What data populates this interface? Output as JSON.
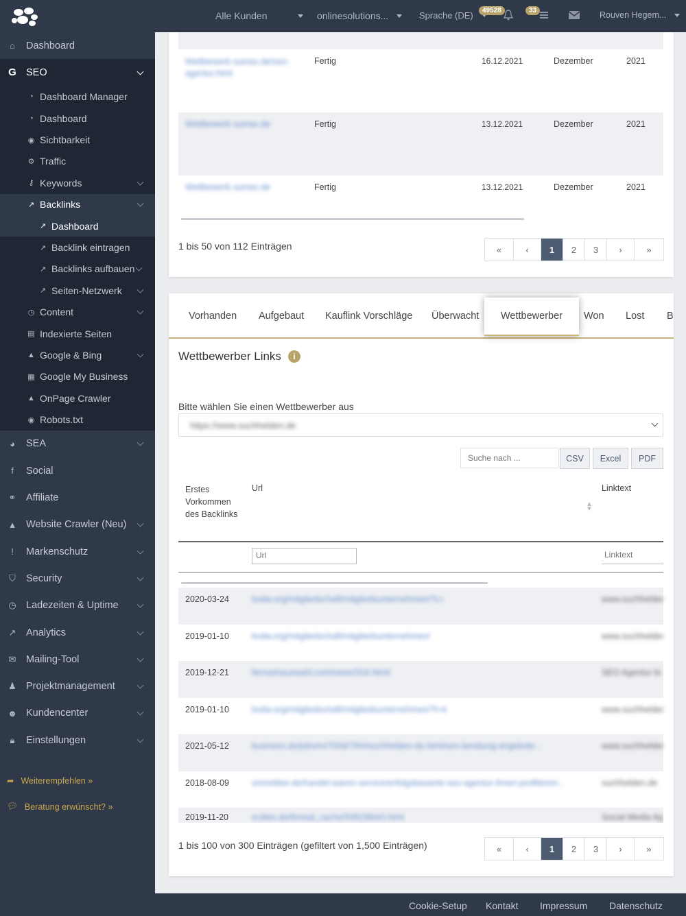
{
  "topbar": {
    "customer": "Alle Kunden",
    "project": "onlinesolutions...",
    "language": "Sprache (DE)",
    "badge1": "49528",
    "badge2": "33",
    "user": "Rouven Hegem..."
  },
  "sidebar": {
    "dashboard": "Dashboard",
    "seo": "SEO",
    "seo_items": [
      {
        "label": "Dashboard Manager"
      },
      {
        "label": "Dashboard"
      },
      {
        "label": "Sichtbarkeit"
      },
      {
        "label": "Traffic"
      },
      {
        "label": "Keywords"
      },
      {
        "label": "Backlinks"
      },
      {
        "label": "Content"
      },
      {
        "label": "Indexierte Seiten"
      },
      {
        "label": "Google & Bing"
      },
      {
        "label": "Google My Business"
      },
      {
        "label": "OnPage Crawler"
      },
      {
        "label": "Robots.txt"
      }
    ],
    "backlinks_items": [
      {
        "label": "Dashboard"
      },
      {
        "label": "Backlink eintragen"
      },
      {
        "label": "Backlinks aufbauen"
      },
      {
        "label": "Seiten-Netzwerk"
      }
    ],
    "main_items": [
      {
        "label": "SEA"
      },
      {
        "label": "Social"
      },
      {
        "label": "Affiliate"
      },
      {
        "label": "Website Crawler (Neu)"
      },
      {
        "label": "Markenschutz"
      },
      {
        "label": "Security"
      },
      {
        "label": "Ladezeiten & Uptime"
      },
      {
        "label": "Analytics"
      },
      {
        "label": "Mailing-Tool"
      },
      {
        "label": "Projektmanagement"
      },
      {
        "label": "Kundencenter"
      },
      {
        "label": "Einstellungen"
      }
    ],
    "weiterempfehlen": "Weiterempfehlen »",
    "beratung": "Beratung erwünscht? »"
  },
  "card1": {
    "rows": [
      {
        "url": "Wettbewerb sumax.de/seo-agentur.html",
        "status": "Fertig",
        "date": "16.12.2021",
        "month": "Dezember",
        "year": "2021"
      },
      {
        "url": "Wettbewerb sumax.de",
        "status": "Fertig",
        "date": "13.12.2021",
        "month": "Dezember",
        "year": "2021"
      },
      {
        "url": "Wettbewerb sumax.de",
        "status": "Fertig",
        "date": "13.12.2021",
        "month": "Dezember",
        "year": "2021"
      }
    ],
    "info": "1 bis 50 von 112 Einträgen",
    "pager": [
      "«",
      "‹",
      "1",
      "2",
      "3",
      "›",
      "»"
    ]
  },
  "card2": {
    "tabs": [
      "Vorhanden",
      "Aufgebaut",
      "Kauflink Vorschläge",
      "Überwacht",
      "Wettbewerber",
      "Won",
      "Lost",
      "Br"
    ],
    "title": "Wettbewerber Links",
    "select_label": "Bitte wählen Sie einen Wettbewerber aus",
    "select_value": "https://www.suchhelden.de",
    "search_placeholder": "Suche nach ...",
    "buttons": [
      "CSV",
      "Excel",
      "PDF"
    ],
    "headers": {
      "first": "Erstes Vorkommen des Backlinks",
      "url": "Url",
      "linktext": "Linktext"
    },
    "filter_url": "Url",
    "filter_linktext": "Linktext",
    "rows": [
      {
        "date": "2020-03-24",
        "url": "bvdw.org/mitgliedschaft/mitgliedsunternehmen/?c=",
        "text": "www.suchhelden"
      },
      {
        "date": "2019-01-10",
        "url": "bvdw.org/mitgliedschaft/mitgliedsunternehmen/",
        "text": "www.suchhelden"
      },
      {
        "date": "2019-12-21",
        "url": "fernsehauswahl.com/news/316.html/",
        "text": "SEO Agentur bi"
      },
      {
        "date": "2019-01-10",
        "url": "bvdw.org/mitgliedschaft/mitgliedsunternehmen/?l=4",
        "text": "www.suchhelden"
      },
      {
        "date": "2021-05-12",
        "url": "business.de/jobs/m/700d/7f44/suchhelden-de.html/seo-beratung-angebote...",
        "text": "www.suchhelden"
      },
      {
        "date": "2018-08-09",
        "url": "onmeldee.de/handel-waren-service/erfolgsbasierte-seo-agentur-ihnen-profitieren...",
        "text": "suchhelden.de"
      },
      {
        "date": "2019-11-20",
        "url": "ecities.de/thread_cache/508198/e0.html",
        "text": "Social Media Ag"
      }
    ],
    "info": "1 bis 100 von 300 Einträgen (gefiltert von 1,500 Einträgen)",
    "pager": [
      "«",
      "‹",
      "1",
      "2",
      "3",
      "›",
      "»"
    ]
  },
  "footer": {
    "items": [
      "Cookie-Setup",
      "Kontakt",
      "Impressum",
      "Datenschutz"
    ]
  }
}
